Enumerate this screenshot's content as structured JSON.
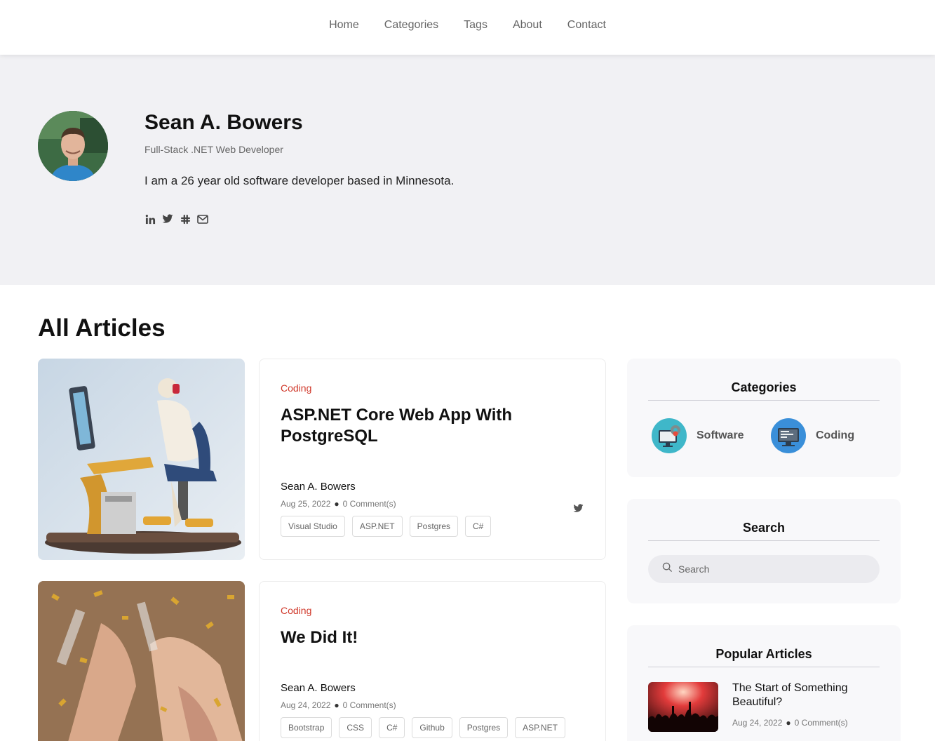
{
  "nav": {
    "items": [
      {
        "label": "Home"
      },
      {
        "label": "Categories"
      },
      {
        "label": "Tags"
      },
      {
        "label": "About"
      },
      {
        "label": "Contact"
      }
    ]
  },
  "profile": {
    "name": "Sean A. Bowers",
    "role": "Full-Stack .NET Web Developer",
    "bio": "I am a 26 year old software developer based in Minnesota.",
    "social_icons": [
      "linkedin-icon",
      "twitter-icon",
      "slack-icon",
      "mail-icon"
    ]
  },
  "articles_heading": "All Articles",
  "articles": [
    {
      "category": "Coding",
      "title": "ASP.NET Core Web App With PostgreSQL",
      "author": "Sean A. Bowers",
      "date": "Aug 25, 2022",
      "comments": "0 Comment(s)",
      "tags": [
        "Visual Studio",
        "ASP.NET",
        "Postgres",
        "C#"
      ]
    },
    {
      "category": "Coding",
      "title": "We Did It!",
      "author": "Sean A. Bowers",
      "date": "Aug 24, 2022",
      "comments": "0 Comment(s)",
      "tags": [
        "Bootstrap",
        "CSS",
        "C#",
        "Github",
        "Postgres",
        "ASP.NET"
      ]
    }
  ],
  "sidebar": {
    "categories": {
      "title": "Categories",
      "items": [
        {
          "label": "Software",
          "icon": "software-gear-monitor-icon"
        },
        {
          "label": "Coding",
          "icon": "code-monitor-icon"
        }
      ]
    },
    "search": {
      "title": "Search",
      "placeholder": "Search"
    },
    "popular": {
      "title": "Popular Articles",
      "items": [
        {
          "title": "The Start of Something Beautiful?",
          "date": "Aug 24, 2022",
          "comments": "0 Comment(s)"
        }
      ]
    }
  },
  "colors": {
    "accent": "#d0392b",
    "hero_bg": "#f1f1f4",
    "sidebar_bg": "#f8f8fa"
  }
}
